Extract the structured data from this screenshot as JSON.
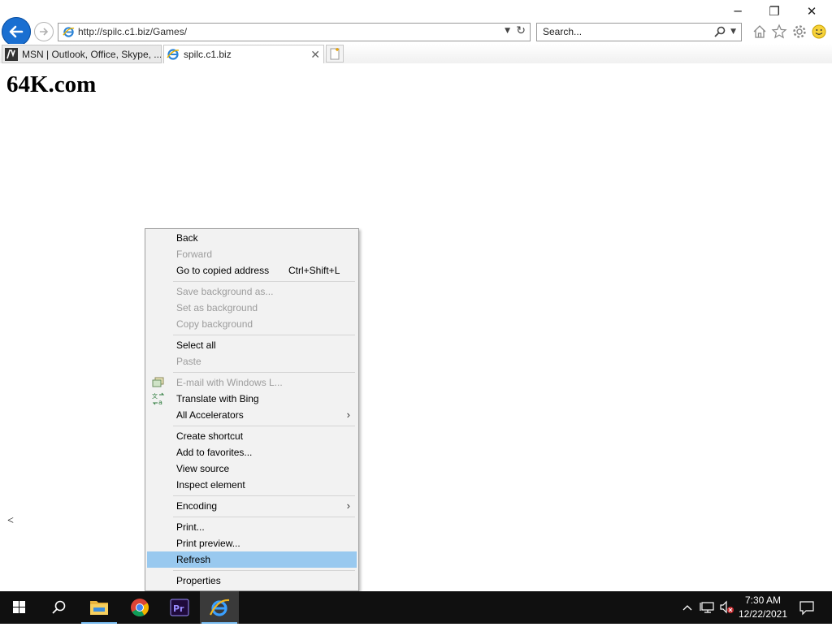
{
  "window": {
    "minimize_glyph": "─",
    "restore_glyph": "❐",
    "close_glyph": "✕"
  },
  "address_bar": {
    "url": "http://spilc.c1.biz/Games/"
  },
  "search_box": {
    "placeholder": "Search..."
  },
  "tabs": [
    {
      "label": "MSN | Outlook, Office, Skype, ...",
      "icon": "msn-icon",
      "active": false
    },
    {
      "label": "spilc.c1.biz",
      "icon": "ie-icon",
      "active": true
    }
  ],
  "page": {
    "heading": "64K.com",
    "stray_text": "<"
  },
  "context_menu": {
    "items": [
      {
        "label": "Back",
        "enabled": true
      },
      {
        "label": "Forward",
        "enabled": false
      },
      {
        "label": "Go to copied address",
        "shortcut": "Ctrl+Shift+L",
        "enabled": true
      },
      {
        "label": "Save background as...",
        "enabled": false
      },
      {
        "label": "Set as background",
        "enabled": false
      },
      {
        "label": "Copy background",
        "enabled": false
      },
      {
        "label": "Select all",
        "enabled": true
      },
      {
        "label": "Paste",
        "enabled": false
      },
      {
        "label": "E-mail with Windows L...",
        "enabled": false,
        "icon": "email-icon"
      },
      {
        "label": "Translate with Bing",
        "enabled": true,
        "icon": "translate-icon"
      },
      {
        "label": "All Accelerators",
        "enabled": true,
        "submenu": true
      },
      {
        "label": "Create shortcut",
        "enabled": true
      },
      {
        "label": "Add to favorites...",
        "enabled": true
      },
      {
        "label": "View source",
        "enabled": true
      },
      {
        "label": "Inspect element",
        "enabled": true
      },
      {
        "label": "Encoding",
        "enabled": true,
        "submenu": true
      },
      {
        "label": "Print...",
        "enabled": true
      },
      {
        "label": "Print preview...",
        "enabled": true
      },
      {
        "label": "Refresh",
        "enabled": true,
        "highlighted": true
      },
      {
        "label": "Properties",
        "enabled": true
      }
    ],
    "submenu_arrow": "›",
    "highlight_color": "#99c9ef"
  },
  "taskbar": {
    "time": "7:30 AM",
    "date": "12/22/2021",
    "apps": [
      "start-icon",
      "search-icon",
      "file-explorer-icon",
      "chrome-icon",
      "premiere-icon",
      "internet-explorer-icon"
    ]
  },
  "colors": {
    "accent": "#1a6fd1",
    "taskbar": "#101010"
  }
}
